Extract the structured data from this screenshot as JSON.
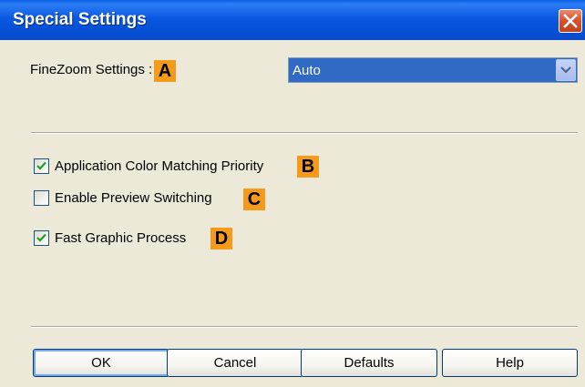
{
  "window": {
    "title": "Special Settings",
    "close_icon": "close-icon"
  },
  "finezoom": {
    "label": "FineZoom Settings :",
    "badge": "A",
    "selected_value": "Auto"
  },
  "options": [
    {
      "label": "Application Color Matching Priority",
      "badge": "B",
      "checked": true
    },
    {
      "label": "Enable Preview Switching",
      "badge": "C",
      "checked": false
    },
    {
      "label": "Fast Graphic Process",
      "badge": "D",
      "checked": true
    }
  ],
  "buttons": {
    "ok": "OK",
    "cancel": "Cancel",
    "defaults": "Defaults",
    "help": "Help"
  },
  "colors": {
    "titlebar": "#0a58e2",
    "badge": "#f59a1b",
    "dialog_bg": "#ece9d8",
    "selection": "#316ac5"
  }
}
